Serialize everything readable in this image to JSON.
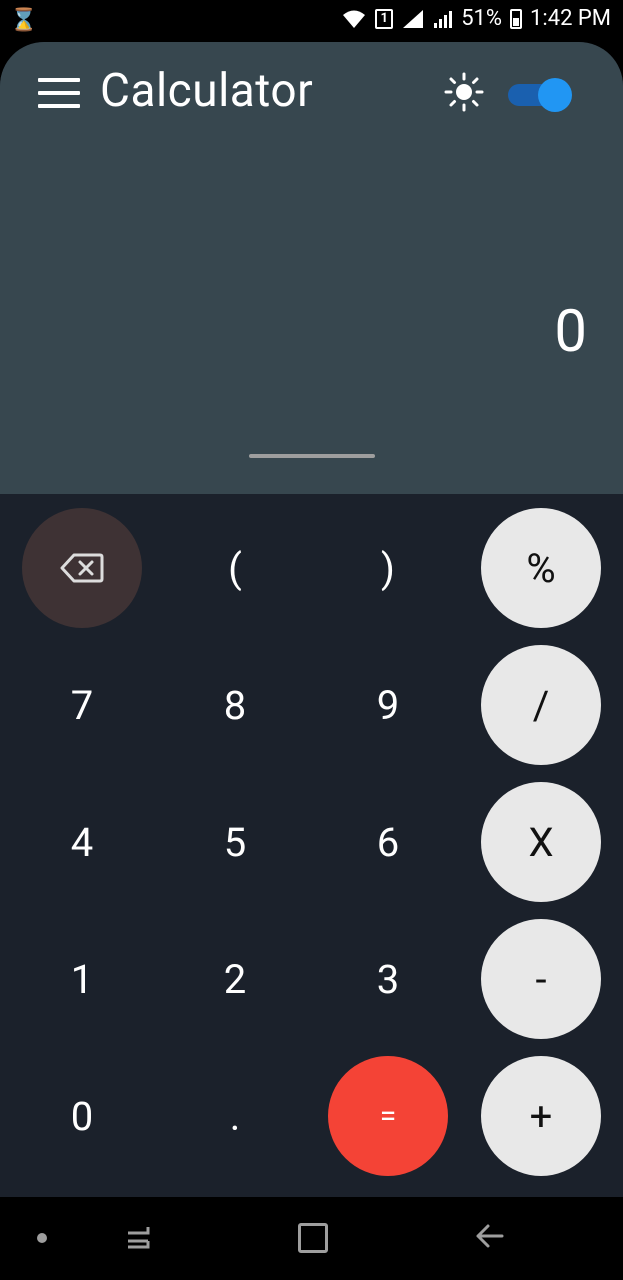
{
  "status_bar": {
    "time": "1:42 PM",
    "battery_percent": "51%",
    "sim_label": "1",
    "left_icon": "hourglass-icon"
  },
  "app": {
    "title": "Calculator",
    "theme_toggle_on": true
  },
  "display": {
    "result": "0"
  },
  "keys": {
    "backspace": "backspace-icon",
    "open_paren": "(",
    "close_paren": ")",
    "percent": "%",
    "seven": "7",
    "eight": "8",
    "nine": "9",
    "divide": "/",
    "four": "4",
    "five": "5",
    "six": "6",
    "multiply": "X",
    "one": "1",
    "two": "2",
    "three": "3",
    "minus": "-",
    "zero": "0",
    "dot": ".",
    "equals": "=",
    "plus": "+"
  },
  "colors": {
    "display_bg": "#37474f",
    "keypad_bg": "#1b212b",
    "operator_bg": "#e8e8e8",
    "equals_bg": "#f44336",
    "backspace_bg": "#3e3234",
    "toggle_accent": "#2196f3"
  }
}
